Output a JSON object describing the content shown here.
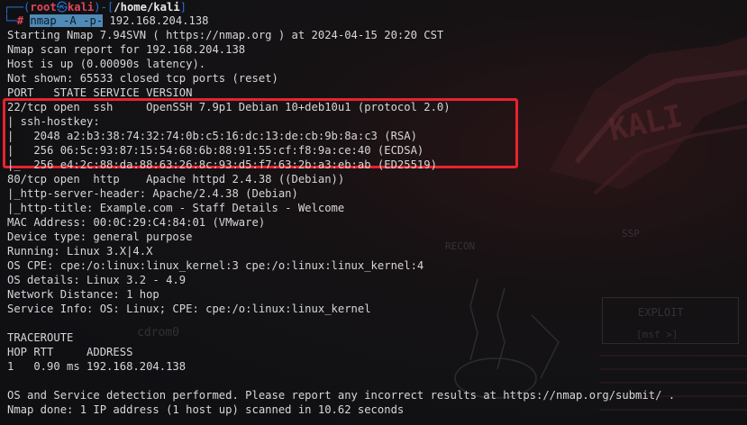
{
  "prompt": {
    "top_left": "┌──(",
    "user": "root",
    "at": "㉿",
    "host": "kali",
    "mid": ")-[",
    "path": "/home/kali",
    "close": "]",
    "bottom_left": "└─",
    "hash": "#",
    "cmd_nmap": "nmap",
    "cmd_space1": " ",
    "cmd_flag_a": "-A",
    "cmd_space2": " ",
    "cmd_flag_p": "-p-",
    "cmd_target": " 192.168.204.138"
  },
  "output": [
    "Starting Nmap 7.94SVN ( https://nmap.org ) at 2024-04-15 20:20 CST",
    "Nmap scan report for 192.168.204.138",
    "Host is up (0.00090s latency).",
    "Not shown: 65533 closed tcp ports (reset)",
    "PORT   STATE SERVICE VERSION",
    "22/tcp open  ssh     OpenSSH 7.9p1 Debian 10+deb10u1 (protocol 2.0)",
    "| ssh-hostkey:",
    "|   2048 a2:b3:38:74:32:74:0b:c5:16:dc:13:de:cb:9b:8a:c3 (RSA)",
    "|   256 06:5c:93:87:15:54:68:6b:88:91:55:cf:f8:9a:ce:40 (ECDSA)",
    "|_  256 e4:2c:88:da:88:63:26:8c:93:d5:f7:63:2b:a3:eb:ab (ED25519)",
    "80/tcp open  http    Apache httpd 2.4.38 ((Debian))",
    "|_http-server-header: Apache/2.4.38 (Debian)",
    "|_http-title: Example.com - Staff Details - Welcome",
    "MAC Address: 00:0C:29:C4:84:01 (VMware)",
    "Device type: general purpose",
    "Running: Linux 3.X|4.X",
    "OS CPE: cpe:/o:linux:linux_kernel:3 cpe:/o:linux:linux_kernel:4",
    "OS details: Linux 3.2 - 4.9",
    "Network Distance: 1 hop",
    "Service Info: OS: Linux; CPE: cpe:/o:linux:linux_kernel",
    "",
    "TRACEROUTE",
    "HOP RTT     ADDRESS",
    "1   0.90 ms 192.168.204.138",
    "",
    "OS and Service detection performed. Please report any incorrect results at https://nmap.org/submit/ .",
    "Nmap done: 1 IP address (1 host up) scanned in 10.62 seconds"
  ],
  "wallpaper": {
    "recon": "RECON",
    "exploit": "EXPLOIT",
    "msf": "[msf >]",
    "cdrom": "cdrom0",
    "ssp": "SSP"
  },
  "colors": {
    "highlight_box": "#e8232f",
    "prompt_blue": "#2a6fd1",
    "prompt_red": "#e0475a",
    "command_highlight": "#4f8bb6"
  }
}
